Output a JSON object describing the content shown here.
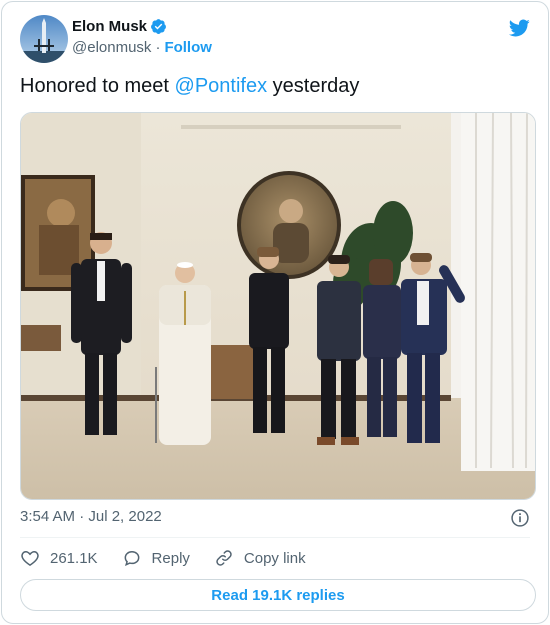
{
  "author": {
    "name": "Elon Musk",
    "handle": "@elonmusk",
    "separator": "·",
    "follow_label": "Follow",
    "avatar_icon": "avatar-rocket-launch"
  },
  "tweet": {
    "text_before": "Honored to meet ",
    "mention": "@Pontifex",
    "text_after": " yesterday",
    "timestamp": "3:54 AM · Jul 2, 2022"
  },
  "actions": {
    "likes": "261.1K",
    "reply_label": "Reply",
    "copy_link_label": "Copy link"
  },
  "replies_button_label": "Read 19.1K replies",
  "colors": {
    "accent": "#1d9bf0",
    "text": "#0f1419",
    "secondary": "#536471",
    "border": "#cfd9de"
  }
}
